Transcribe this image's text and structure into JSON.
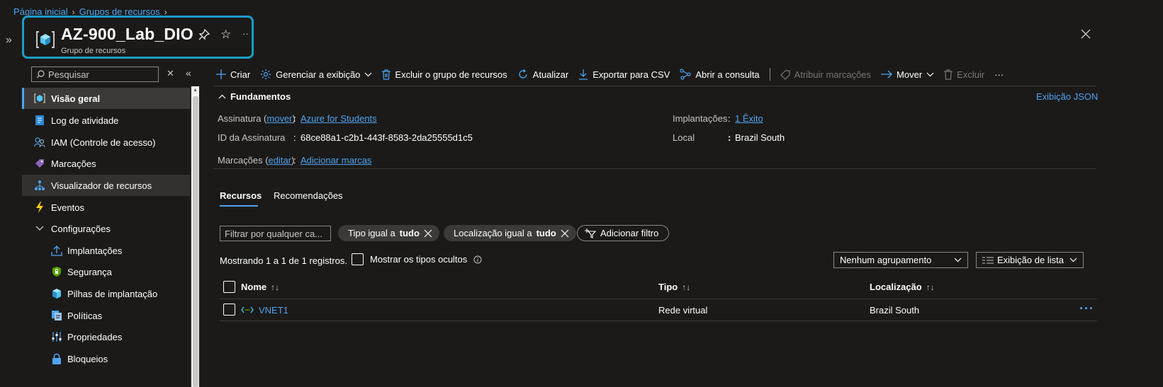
{
  "breadcrumb": {
    "items": [
      "Página inicial",
      "Grupos de recursos"
    ]
  },
  "header": {
    "title": "AZ-900_Lab_DIO",
    "subtitle": "Grupo de recursos"
  },
  "colors": {
    "accent": "#4ea4f1",
    "highlight_box": "#1a9ec4",
    "background": "#1b1a19"
  },
  "sidebar": {
    "search_placeholder": "Pesquisar",
    "items": [
      {
        "label": "Visão geral",
        "icon": "resource-group-icon"
      },
      {
        "label": "Log de atividade",
        "icon": "activity-log-icon"
      },
      {
        "label": "IAM (Controle de acesso)",
        "icon": "iam-icon"
      },
      {
        "label": "Marcações",
        "icon": "tag-icon"
      },
      {
        "label": "Visualizador de recursos",
        "icon": "resource-visualizer-icon"
      },
      {
        "label": "Eventos",
        "icon": "lightning-icon"
      },
      {
        "label": "Configurações",
        "icon": "chevron-down-icon"
      },
      {
        "label": "Implantações",
        "icon": "deploy-icon"
      },
      {
        "label": "Segurança",
        "icon": "security-icon"
      },
      {
        "label": "Pilhas de implantação",
        "icon": "deployment-stack-icon"
      },
      {
        "label": "Políticas",
        "icon": "policy-icon"
      },
      {
        "label": "Propriedades",
        "icon": "properties-icon"
      },
      {
        "label": "Bloqueios",
        "icon": "lock-icon"
      }
    ]
  },
  "toolbar": {
    "create": "Criar",
    "manage_view": "Gerenciar a exibição",
    "delete_group": "Excluir o grupo de recursos",
    "refresh": "Atualizar",
    "export_csv": "Exportar para CSV",
    "open_query": "Abrir a consulta",
    "assign_tags": "Atribuir marcações",
    "move": "Mover",
    "delete": "Excluir"
  },
  "essentials": {
    "title": "Fundamentos",
    "json_view": "Exibição JSON",
    "subscription_label": "Assinatura",
    "subscription_action": "mover",
    "subscription_value": "Azure for Students",
    "subscription_id_label": "ID da Assinatura",
    "subscription_id_value": "68ce88a1-c2b1-443f-8583-2da25555d1c5",
    "tags_label": "Marcações",
    "tags_action": "editar",
    "tags_value": "Adicionar marcas",
    "deployments_label": "Implantações",
    "deployments_value": "1 Êxito",
    "location_label": "Local",
    "location_value": "Brazil South"
  },
  "tabs": [
    "Recursos",
    "Recomendações"
  ],
  "filters": {
    "placeholder": "Filtrar por qualquer ca...",
    "type_prefix": "Tipo igual a",
    "type_value": "tudo",
    "location_prefix": "Localização igual a",
    "location_value": "tudo",
    "add_filter": "Adicionar filtro"
  },
  "records": {
    "showing": "Mostrando 1 a 1 de 1 registros.",
    "show_hidden": "Mostrar os tipos ocultos",
    "grouping": "Nenhum agrupamento",
    "view": "Exibição de lista"
  },
  "table": {
    "columns": [
      "Nome",
      "Tipo",
      "Localização"
    ],
    "rows": [
      {
        "name": "VNET1",
        "type": "Rede virtual",
        "location": "Brazil South"
      }
    ]
  }
}
